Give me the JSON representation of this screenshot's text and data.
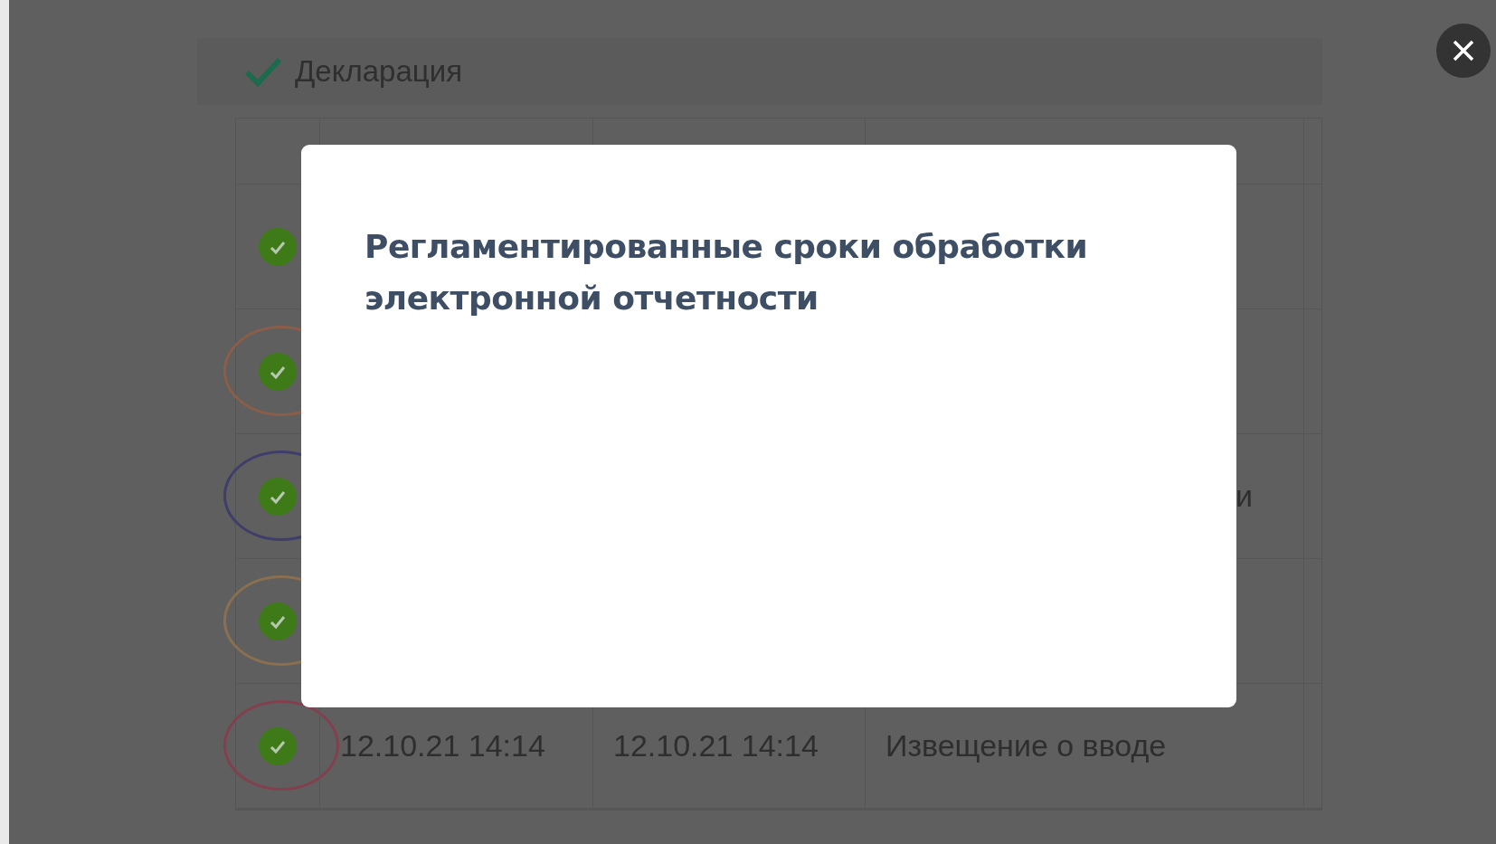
{
  "panel": {
    "title": "Декларация"
  },
  "table": {
    "rows": [
      {},
      {
        "color": "#8a5e48"
      },
      {
        "color": "#3f3d6b",
        "column_4": "и"
      },
      {
        "color": "#8a7050"
      },
      {
        "color": "#82404f",
        "column_2": "12.10.21 14:14",
        "column_3": "12.10.21 14:14",
        "column_4": "Извещение о вводе"
      }
    ]
  },
  "modal": {
    "title": "Регламентированные сроки обработки электронной отчетности"
  }
}
